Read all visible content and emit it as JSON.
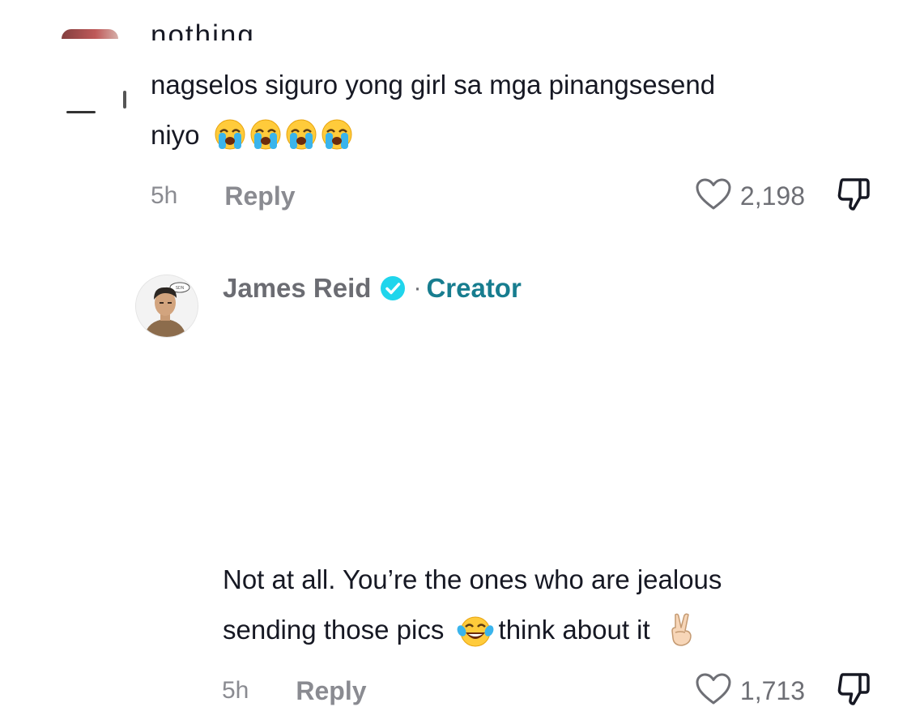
{
  "comments": [
    {
      "cut_text": "nothing",
      "text_line1": "nagselos siguro yong girl sa mga pinangsesend",
      "text_line2": "niyo",
      "emoji": [
        "loudly-crying-face",
        "loudly-crying-face",
        "loudly-crying-face",
        "loudly-crying-face"
      ],
      "time": "5h",
      "reply_label": "Reply",
      "like_count": "2,198"
    },
    {
      "username": "James Reid",
      "separator": "·",
      "badge": "Creator",
      "text_line1": "Not at all. You’re the ones who are jealous",
      "text_line2_a": "sending those pics",
      "text_line2_b": "think about it",
      "emoji": [
        "face-with-tears-of-joy",
        "victory-hand"
      ],
      "time": "5h",
      "reply_label": "Reply",
      "like_count": "1,713"
    }
  ],
  "icons": [
    "heart-icon",
    "dislike-icon",
    "verified-badge-icon"
  ],
  "colors": {
    "text": "#161823",
    "muted": "#8a8b91",
    "creator": "#177d8f",
    "verified": "#20d5ec"
  }
}
